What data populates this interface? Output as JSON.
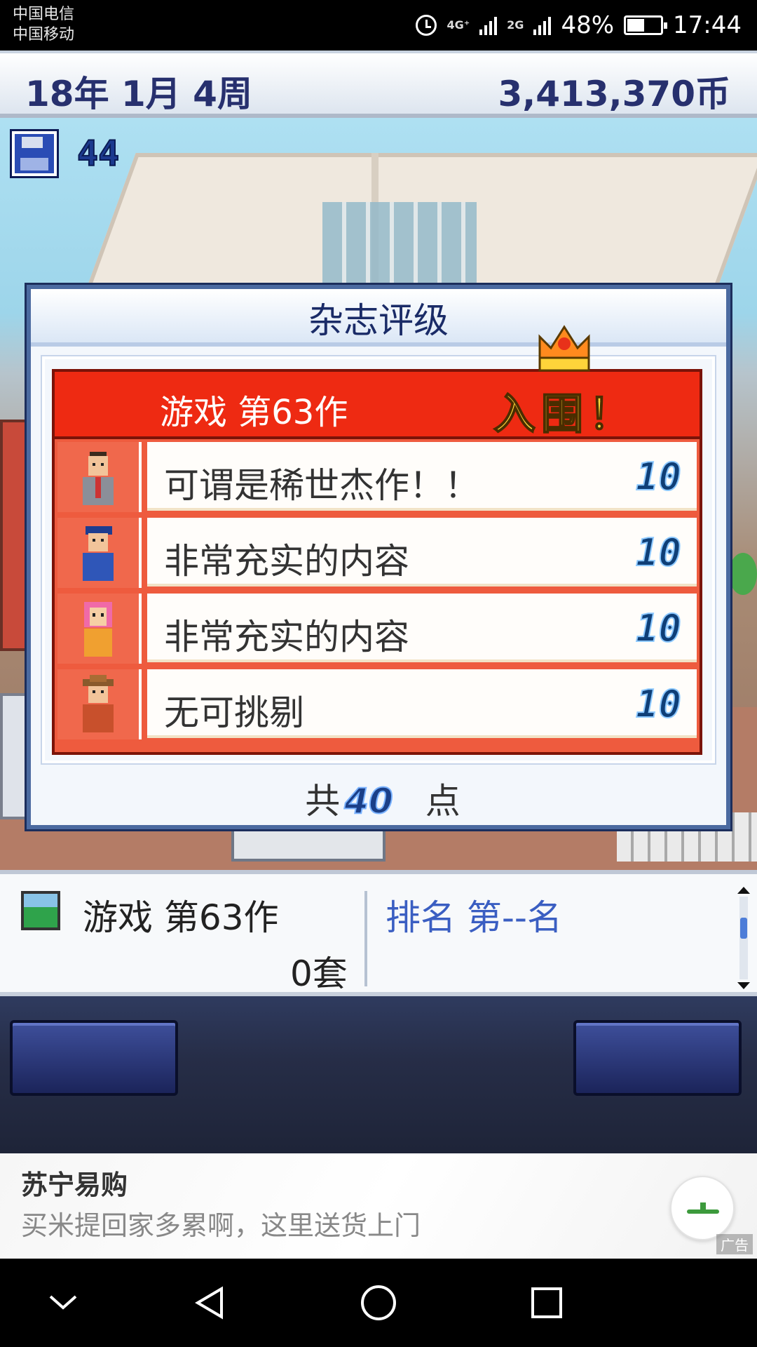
{
  "status_bar": {
    "carrier_1": "中国电信",
    "carrier_2": "中国移动",
    "network_1": "4G⁺",
    "network_2": "2G",
    "battery": "48%",
    "time": "17:44"
  },
  "top_bar": {
    "date": "18年 1月 4周",
    "money": "3,413,370币"
  },
  "save": {
    "count": "44",
    "icon": "floppy-disk-icon"
  },
  "dialog": {
    "title": "杂志评级",
    "game_name": "游戏 第63作",
    "badge": "入围！",
    "reviews": [
      {
        "comment": "可谓是稀世杰作！！",
        "score": "10",
        "reviewer": "businessman-avatar"
      },
      {
        "comment": "非常充实的内容",
        "score": "10",
        "reviewer": "cap-man-avatar"
      },
      {
        "comment": "非常充实的内容",
        "score": "10",
        "reviewer": "pink-hair-girl-avatar"
      },
      {
        "comment": "无可挑剔",
        "score": "10",
        "reviewer": "cowboy-avatar"
      }
    ],
    "total_prefix": "共",
    "total_value": "40",
    "total_suffix": "点"
  },
  "info_bar": {
    "game_title": "游戏 第63作",
    "sales": "0套",
    "rank": "排名 第--名"
  },
  "ad": {
    "title": "苏宁易购",
    "description": "买米提回家多累啊，这里送货上门",
    "tag": "广告"
  },
  "colors": {
    "accent_red": "#ee2a12",
    "navy": "#27306e",
    "rank_blue": "#3a5ec2"
  }
}
